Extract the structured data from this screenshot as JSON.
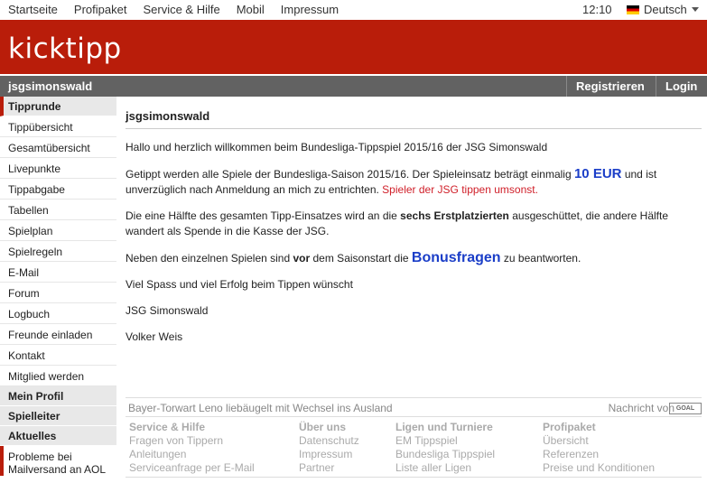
{
  "topnav": {
    "links": [
      "Startseite",
      "Profipaket",
      "Service & Hilfe",
      "Mobil",
      "Impressum"
    ],
    "time": "12:10",
    "language": "Deutsch"
  },
  "header": {
    "logo": "kicktipp"
  },
  "groupbar": {
    "name": "jsgsimonswald",
    "register": "Registrieren",
    "login": "Login"
  },
  "sidebar": {
    "tipprunde": "Tipprunde",
    "items": [
      "Tippübersicht",
      "Gesamtübersicht",
      "Livepunkte",
      "Tippabgabe",
      "Tabellen",
      "Spielplan",
      "Spielregeln",
      "E-Mail",
      "Forum",
      "Logbuch",
      "Freunde einladen",
      "Kontakt",
      "Mitglied werden"
    ],
    "profil": "Mein Profil",
    "spielleiter": "Spielleiter",
    "aktuelles": "Aktuelles",
    "news": "Probleme bei Mailversand an AOL"
  },
  "main": {
    "title": "jsgsimonswald",
    "p1": "Hallo und herzlich willkommen beim Bundesliga-Tippspiel 2015/16 der JSG Simonswald",
    "p2a": "Getippt werden alle Spiele der Bundesliga-Saison 2015/16. Der Spieleinsatz beträgt einmalig ",
    "p2b": "10 EUR",
    "p2c": " und ist unverzüglich nach Anmeldung an mich zu entrichten. ",
    "p2d": "Spieler der JSG tippen umsonst.",
    "p3a": "Die eine Hälfte des gesamten Tipp-Einsatzes wird an die ",
    "p3b": "sechs Erstplatzierten",
    "p3c": " ausgeschüttet, die andere Hälfte wandert als Spende in die Kasse der JSG.",
    "p4a": "Neben den einzelnen Spielen sind ",
    "p4b": "vor",
    "p4c": " dem Saisonstart die ",
    "p4d": "Bonusfragen",
    "p4e": " zu beantworten.",
    "p5": "Viel Spass und viel Erfolg beim Tippen wünscht",
    "p6": "JSG Simonswald",
    "p7": "Volker Weis"
  },
  "ticker": {
    "headline": "Bayer-Torwart Leno liebäugelt mit Wechsel ins Ausland",
    "source": "Nachricht von",
    "logo": "GOAL"
  },
  "footer": {
    "col1": {
      "heading": "Service & Hilfe",
      "links": [
        "Fragen von Tippern",
        "Anleitungen",
        "Serviceanfrage per E-Mail"
      ]
    },
    "col2": {
      "heading": "Über uns",
      "links": [
        "Datenschutz",
        "Impressum",
        "Partner"
      ]
    },
    "col3": {
      "heading": "Ligen und Turniere",
      "links": [
        "EM Tippspiel",
        "Bundesliga Tippspiel",
        "Liste aller Ligen"
      ]
    },
    "col4": {
      "heading": "Profipaket",
      "links": [
        "Übersicht",
        "Referenzen",
        "Preise und Konditionen"
      ]
    }
  }
}
